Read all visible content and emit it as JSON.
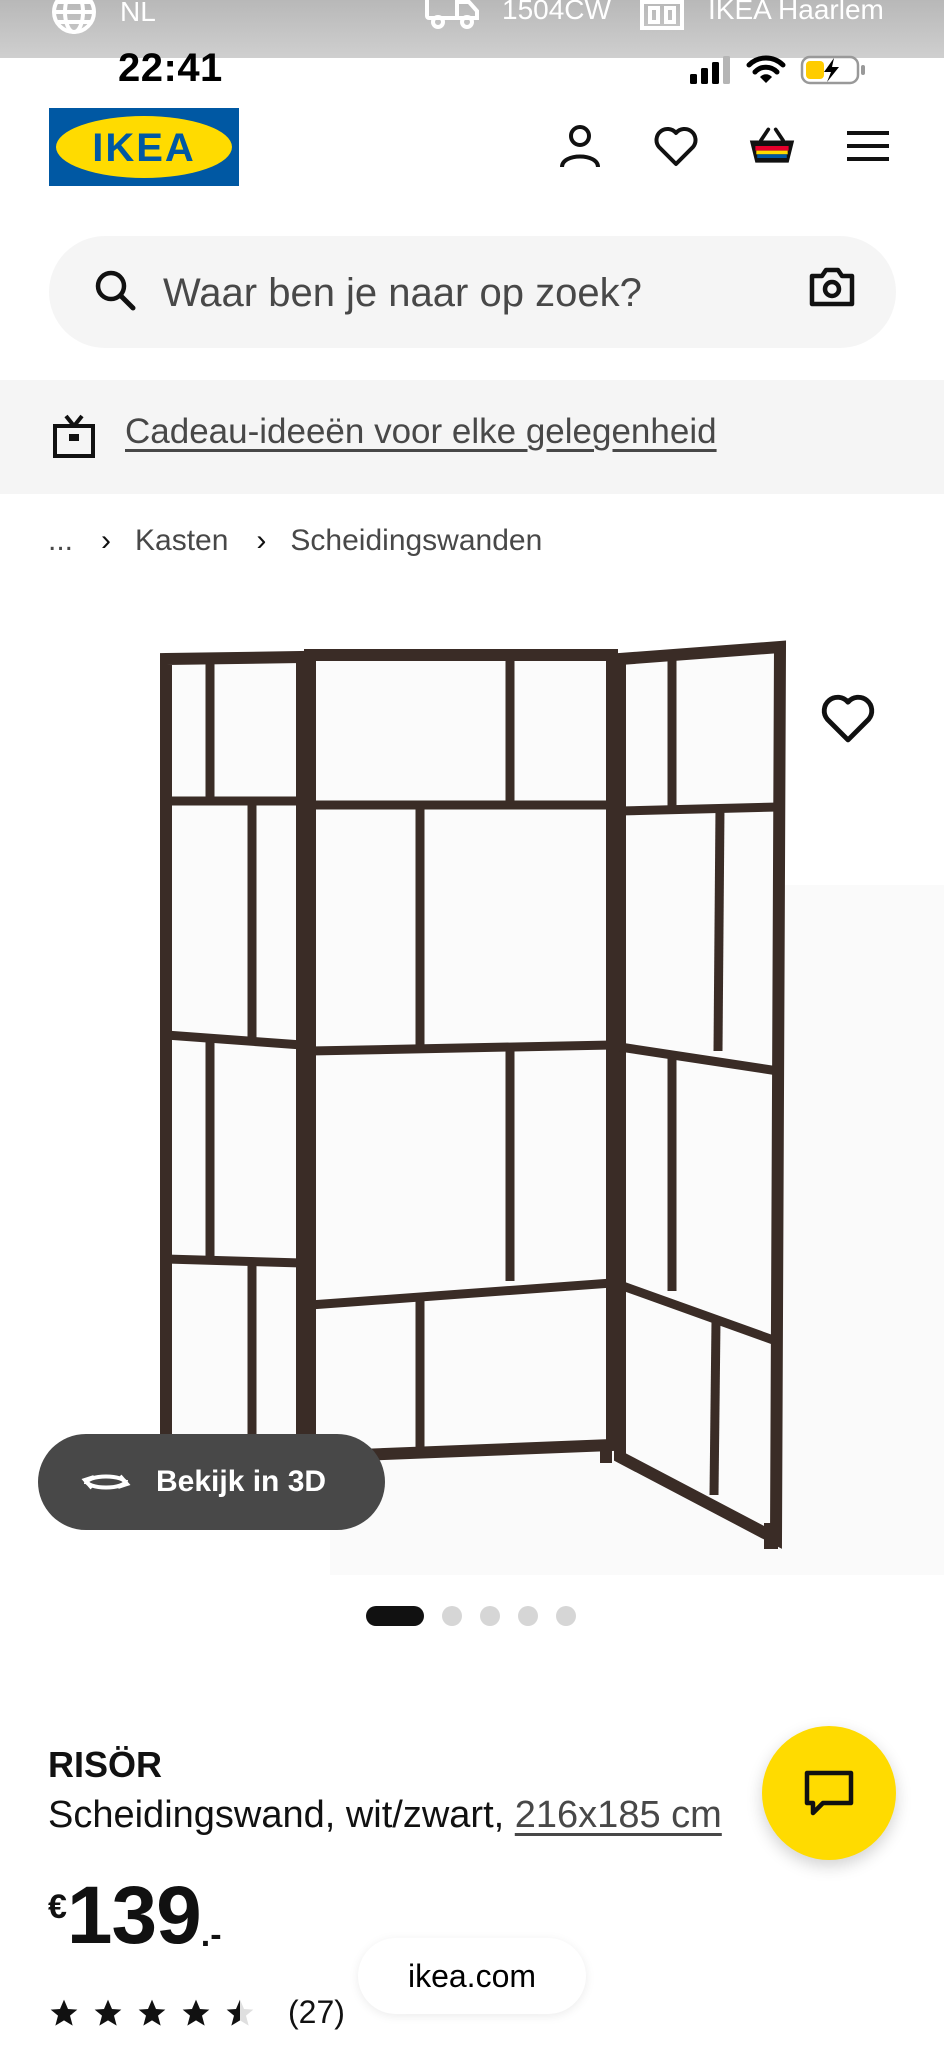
{
  "utility_bar": {
    "language": "NL",
    "postcode": "1504CW",
    "store": "IKEA Haarlem"
  },
  "status_bar": {
    "time": "22:41"
  },
  "header": {
    "logo_text": "IKEA",
    "brand_colors": {
      "blue": "#0058a3",
      "yellow": "#ffdb00"
    }
  },
  "search": {
    "placeholder": "Waar ben je naar op zoek?"
  },
  "promo": {
    "text": "Cadeau-ideeën voor elke gelegenheid"
  },
  "breadcrumb": {
    "ellipsis": "...",
    "items": [
      "Kasten",
      "Scheidingswanden"
    ]
  },
  "gallery": {
    "view_3d_label": "Bekijk in 3D",
    "slide_count": 5,
    "active_slide": 1
  },
  "product": {
    "name": "RISÖR",
    "description": "Scheidingswand, wit/zwart,",
    "dimensions": "216x185 cm",
    "price": {
      "currency": "€",
      "integer": "139",
      "decimal": ".-"
    },
    "rating": {
      "stars": 4.5,
      "max": 5,
      "count": "(27)"
    }
  },
  "browser": {
    "url": "ikea.com"
  }
}
